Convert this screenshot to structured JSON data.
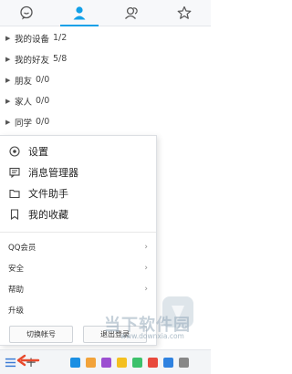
{
  "tabs": [
    {
      "icon": "chat-bubble-icon"
    },
    {
      "icon": "contact-person-icon",
      "active": true
    },
    {
      "icon": "group-chat-icon"
    },
    {
      "icon": "star-icon"
    }
  ],
  "groups": [
    {
      "name": "我的设备",
      "count": "1/2"
    },
    {
      "name": "我的好友",
      "count": "5/8"
    },
    {
      "name": "朋友",
      "count": "0/0"
    },
    {
      "name": "家人",
      "count": "0/0"
    },
    {
      "name": "同学",
      "count": "0/0"
    }
  ],
  "menu": {
    "primary": [
      {
        "label": "设置",
        "icon": "settings-icon"
      },
      {
        "label": "消息管理器",
        "icon": "message-manager-icon"
      },
      {
        "label": "文件助手",
        "icon": "folder-icon"
      },
      {
        "label": "我的收藏",
        "icon": "bookmark-icon"
      }
    ],
    "secondary": [
      {
        "label": "QQ会员",
        "has_submenu": true
      },
      {
        "label": "安全",
        "has_submenu": true
      },
      {
        "label": "帮助",
        "has_submenu": true
      },
      {
        "label": "升级",
        "has_submenu": false
      }
    ],
    "switch_account": "切换帐号",
    "logout": "退出登录"
  },
  "watermark": {
    "cn": "当下软件园",
    "url": "www.downxia.com"
  },
  "colors": {
    "accent": "#12a0e8",
    "arrow": "#e8492c"
  }
}
